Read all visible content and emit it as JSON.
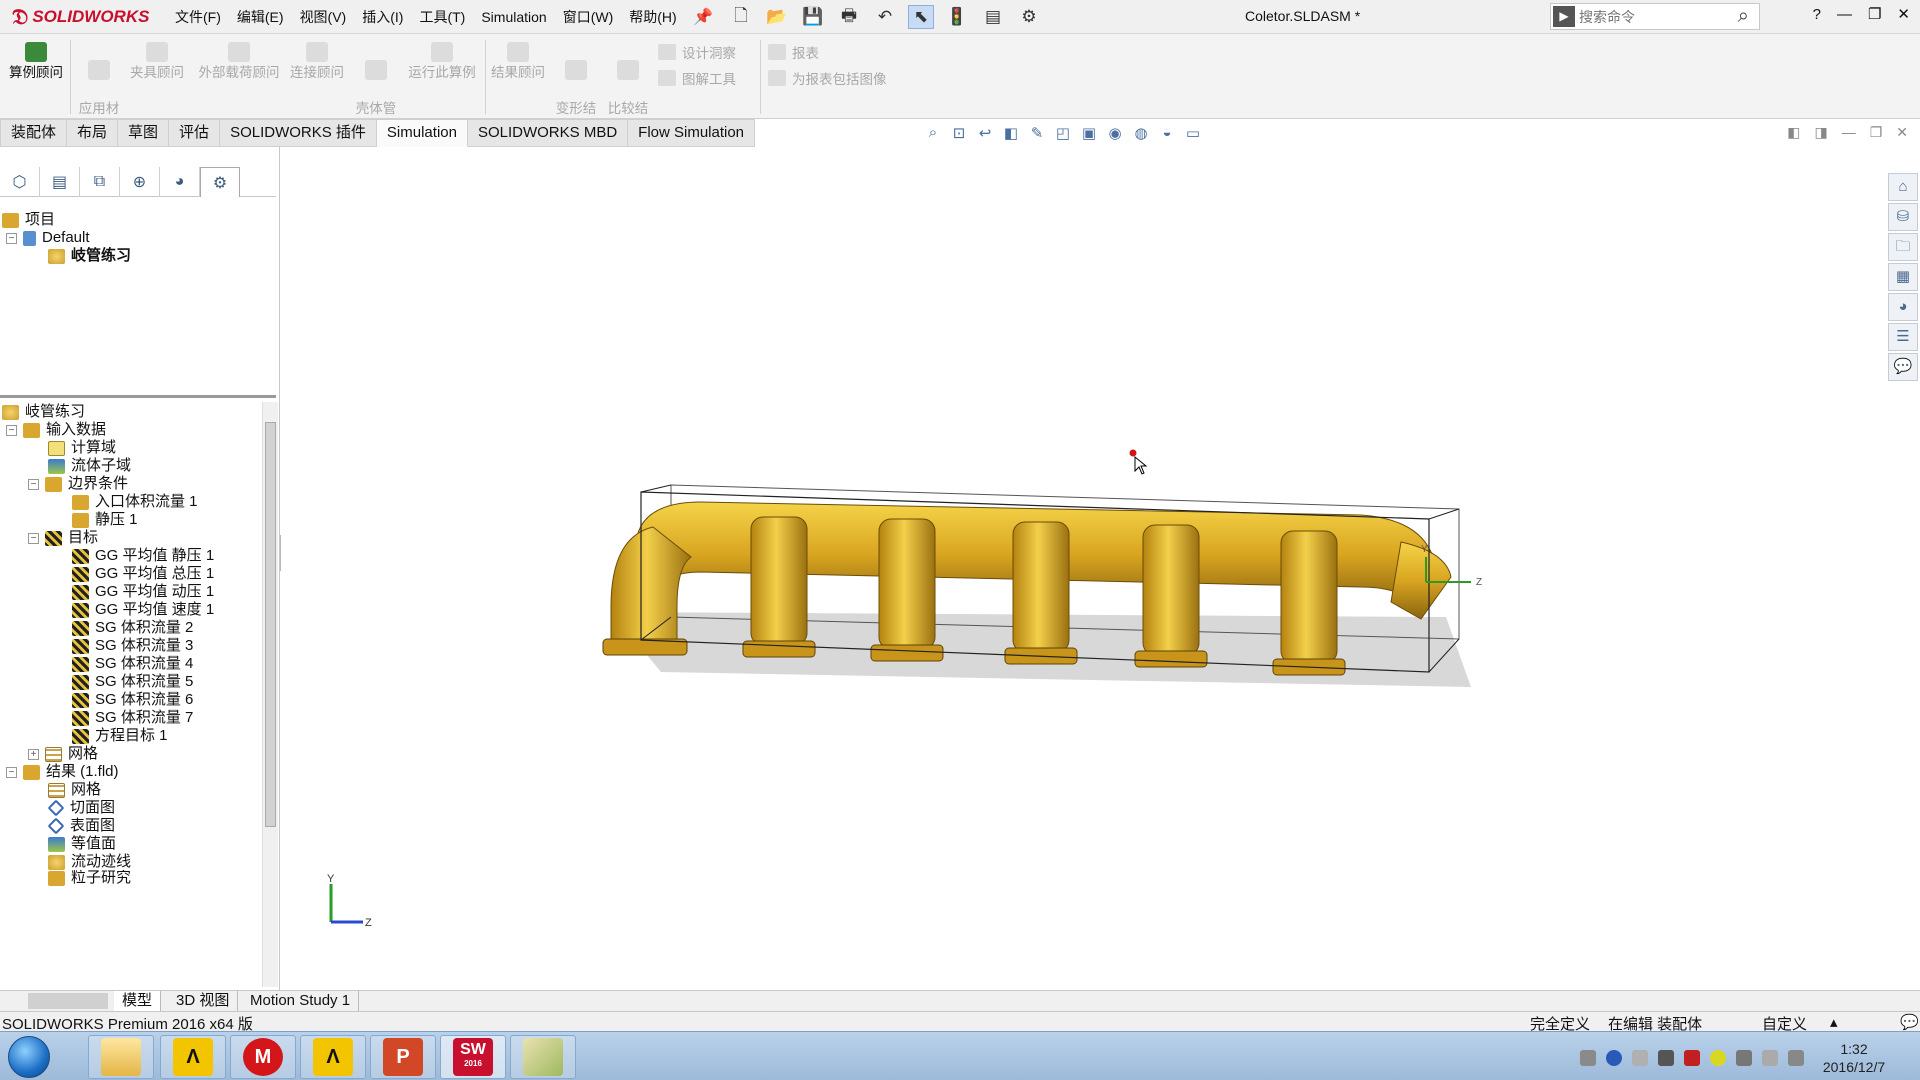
{
  "app": {
    "logo_text": "SOLIDWORKS",
    "document_title": "Coletor.SLDASM *",
    "menus": [
      "文件(F)",
      "编辑(E)",
      "视图(V)",
      "插入(I)",
      "工具(T)",
      "Simulation",
      "窗口(W)",
      "帮助(H)"
    ],
    "search_placeholder": "搜索命令",
    "help_label": "?"
  },
  "commands": {
    "big": [
      {
        "label": "算例顾问",
        "enabled": true
      },
      {
        "label": "应用材\n料",
        "enabled": false
      },
      {
        "label": "夹具顾问",
        "enabled": false
      },
      {
        "label": "外部载荷顾问",
        "enabled": false
      },
      {
        "label": "连接顾问",
        "enabled": false
      },
      {
        "label": "壳体管\n理器",
        "enabled": false
      },
      {
        "label": "运行此算例",
        "enabled": false
      },
      {
        "label": "结果顾问",
        "enabled": false
      },
      {
        "label": "变形结\n果",
        "enabled": false
      },
      {
        "label": "比较结\n果",
        "enabled": false
      }
    ],
    "small": [
      "设计洞察",
      "图解工具",
      "报表",
      "为报表包括图像"
    ]
  },
  "tabs": [
    {
      "label": "装配体",
      "active": false
    },
    {
      "label": "布局",
      "active": false
    },
    {
      "label": "草图",
      "active": false
    },
    {
      "label": "评估",
      "active": false
    },
    {
      "label": "SOLIDWORKS 插件",
      "active": false
    },
    {
      "label": "Simulation",
      "active": true
    },
    {
      "label": "SOLIDWORKS MBD",
      "active": false
    },
    {
      "label": "Flow Simulation",
      "active": false
    }
  ],
  "config_tree": {
    "root": "项目",
    "config": "Default",
    "project": "岐管练习"
  },
  "analysis_tree": {
    "root": "岐管练习",
    "input_data": "输入数据",
    "computational_domain": "计算域",
    "fluid_subdomain": "流体子域",
    "boundary_conditions": "边界条件",
    "inlet_flow": "入口体积流量 1",
    "static_pressure": "静压 1",
    "goals": "目标",
    "goal_items": [
      "GG 平均值 静压 1",
      "GG 平均值 总压 1",
      "GG 平均值 动压 1",
      "GG 平均值 速度 1",
      "SG 体积流量 2",
      "SG 体积流量 3",
      "SG 体积流量 4",
      "SG 体积流量 5",
      "SG 体积流量 6",
      "SG 体积流量 7"
    ],
    "equation_goal": "方程目标 1",
    "mesh": "网格",
    "results": "结果 (1.fld)",
    "result_items": [
      "网格",
      "切面图",
      "表面图",
      "等值面",
      "流动迹线",
      "粒子研究"
    ]
  },
  "triad": {
    "y": "Y",
    "z": "Z"
  },
  "model_tabs": [
    "模型",
    "3D 视图",
    "Motion Study 1"
  ],
  "status": {
    "product": "SOLIDWORKS Premium 2016 x64 版",
    "definition": "完全定义",
    "editing": "在编辑 装配体",
    "custom": "自定义"
  },
  "taskbar": {
    "time": "1:32",
    "date": "2016/12/7",
    "sw_badge": "SW",
    "sw_year": "2016"
  },
  "colors": {
    "brand": "#c8102e",
    "model_gold": "#d9a520",
    "accent": "#3b8a3b"
  }
}
